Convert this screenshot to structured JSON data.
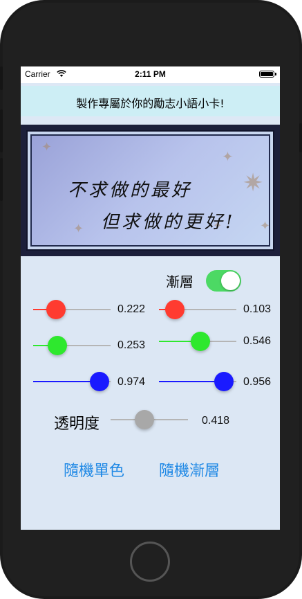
{
  "status": {
    "carrier": "Carrier",
    "time": "2:11 PM"
  },
  "header": {
    "title": "製作專屬於你的勵志小語小卡!"
  },
  "card": {
    "line1": "不求做的最好",
    "line2": "但求做的更好!"
  },
  "gradient": {
    "label": "漸層",
    "enabled": true,
    "accent": "#4cd964"
  },
  "sliders": {
    "left": [
      {
        "color": "#ff3b30",
        "value": 0.222,
        "display": "0.222"
      },
      {
        "color": "#2ee82e",
        "value": 0.253,
        "display": "0.253"
      },
      {
        "color": "#1a1aff",
        "value": 0.974,
        "display": "0.974"
      }
    ],
    "right": [
      {
        "color": "#ff3b30",
        "value": 0.103,
        "display": "0.103"
      },
      {
        "color": "#2ee82e",
        "value": 0.546,
        "display": "0.546"
      },
      {
        "color": "#1a1aff",
        "value": 0.956,
        "display": "0.956"
      }
    ],
    "alpha": {
      "label": "透明度",
      "value": 0.418,
      "display": "0.418",
      "color": "#a8a8a8"
    }
  },
  "buttons": {
    "random_single": "隨機單色",
    "random_gradient": "隨機漸層",
    "color": "#1e88e5"
  }
}
